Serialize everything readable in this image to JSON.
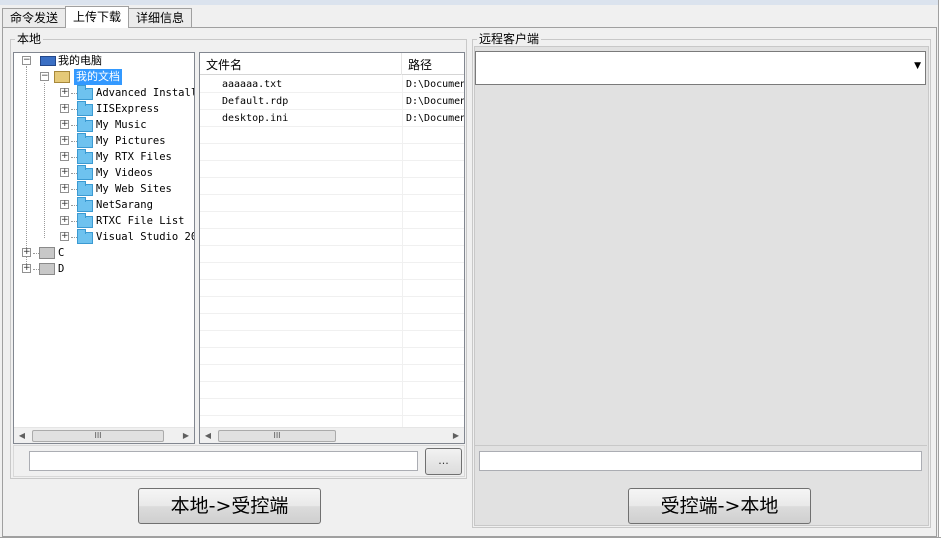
{
  "tabs": [
    {
      "label": "命令发送",
      "active": false
    },
    {
      "label": "上传下载",
      "active": true
    },
    {
      "label": "详细信息",
      "active": false
    }
  ],
  "local": {
    "group_title": "本地",
    "tree": {
      "root_label": "我的电脑",
      "selected_label": "我的文档",
      "folders": [
        "Advanced Install",
        "IISExpress",
        "My Music",
        "My Pictures",
        "My RTX Files",
        "My Videos",
        "My Web Sites",
        "NetSarang",
        "RTXC File List",
        "Visual Studio 20"
      ],
      "drives": [
        "C",
        "D"
      ]
    },
    "list": {
      "columns": [
        "文件名",
        "路径"
      ],
      "rows": [
        {
          "name": "aaaaaa.txt",
          "path": "D:\\Documen"
        },
        {
          "name": "Default.rdp",
          "path": "D:\\Documen"
        },
        {
          "name": "desktop.ini",
          "path": "D:\\Documen"
        }
      ]
    },
    "path_value": "",
    "browse_label": "...",
    "upload_button": "本地->受控端",
    "scroll_grip": "III"
  },
  "remote": {
    "group_title": "远程客户端",
    "combo_value": "",
    "path_value": "",
    "download_button": "受控端->本地"
  },
  "colors": {
    "selection": "#3399ff",
    "folder": "#6ec2ef",
    "panel": "#f0f0f0",
    "remote_panel": "#e1e1e1"
  }
}
